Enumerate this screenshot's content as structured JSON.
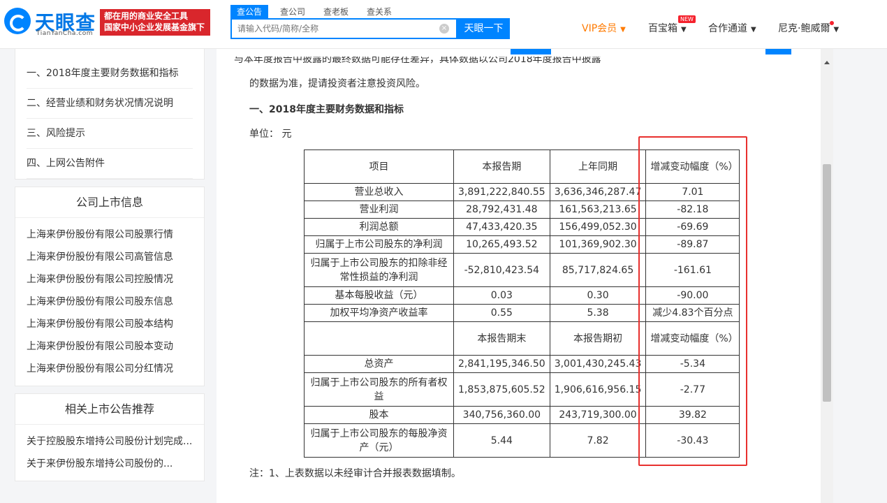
{
  "header": {
    "logo_title": "天眼查",
    "logo_sub": "TianYanCha.com",
    "slogan_line1": "都在用的商业安全工具",
    "slogan_line2": "国家中小企业发展基金旗下",
    "search_tabs": [
      "查公告",
      "查公司",
      "查老板",
      "查关系"
    ],
    "search_placeholder": "请输入代码/简称/全称",
    "search_button": "天眼一下",
    "nav": {
      "vip": "VIP会员",
      "baibao": "百宝箱",
      "new_badge": "NEW",
      "hezuo": "合作通道",
      "user": "尼克·鲍威爾"
    }
  },
  "sidebar": {
    "toc": [
      "一、2018年度主要财务数据和指标",
      "二、经营业绩和财务状况情况说明",
      "三、风险提示",
      "四、上网公告附件"
    ],
    "listing_title": "公司上市信息",
    "listing_links": [
      "上海来伊份股份有限公司股票行情",
      "上海来伊份股份有限公司高管信息",
      "上海来伊份股份有限公司控股情况",
      "上海来伊份股份有限公司股东信息",
      "上海来伊份股份有限公司股本结构",
      "上海来伊份股份有限公司股本变动",
      "上海来伊份股份有限公司分红情况"
    ],
    "related_title": "相关上市公告推荐",
    "related_links": [
      "关于控股股东增持公司股份计划完成...",
      "关于来伊份股东增持公司股份的..."
    ]
  },
  "content": {
    "para_line": "的数据为准，提请投资者注意投资风险。",
    "cut_line": "与本年度报告中披露的最终数据可能存在差异，具体数据以公司2018年度报告中披露",
    "heading": "一、2018年度主要财务数据和指标",
    "unit": "单位：  元",
    "note": "注：1、上表数据以未经审计合并报表数据填制。",
    "table": {
      "header1": [
        "项目",
        "本报告期",
        "上年同期",
        "增减变动幅度（%）"
      ],
      "rows1": [
        [
          "营业总收入",
          "3,891,222,840.55",
          "3,636,346,287.47",
          "7.01"
        ],
        [
          "营业利润",
          "28,792,431.48",
          "161,563,213.65",
          "-82.18"
        ],
        [
          "利润总额",
          "47,433,420.35",
          "156,499,052.30",
          "-69.69"
        ],
        [
          "归属于上市公司股东的净利润",
          "10,265,493.52",
          "101,369,902.30",
          "-89.87"
        ],
        [
          "归属于上市公司股东的扣除非经常性损益的净利润",
          "-52,810,423.54",
          "85,717,824.65",
          "-161.61"
        ],
        [
          "基本每股收益（元）",
          "0.03",
          "0.30",
          "-90.00"
        ],
        [
          "加权平均净资产收益率",
          "0.55",
          "5.38",
          "减少4.83个百分点"
        ]
      ],
      "header2": [
        "",
        "本报告期末",
        "本报告期初",
        "增减变动幅度（%）"
      ],
      "rows2": [
        [
          "总资产",
          "2,841,195,346.50",
          "3,001,430,245.43",
          "-5.34"
        ],
        [
          "归属于上市公司股东的所有者权益",
          "1,853,875,605.52",
          "1,906,616,956.15",
          "-2.77"
        ],
        [
          "股本",
          "340,756,360.00",
          "243,719,300.00",
          "39.82"
        ],
        [
          "归属于上市公司股东的每股净资产（元）",
          "5.44",
          "7.82",
          "-30.43"
        ]
      ]
    }
  }
}
